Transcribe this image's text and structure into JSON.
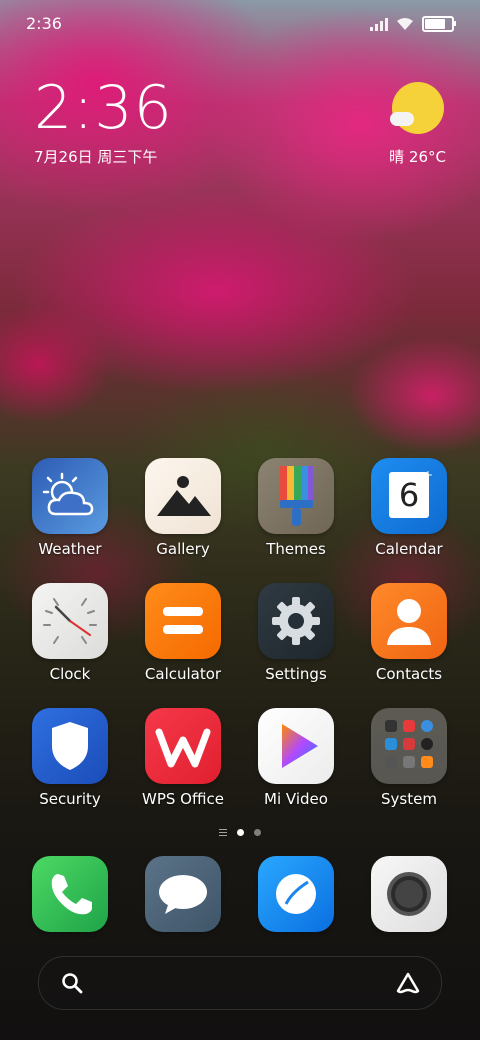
{
  "status_bar": {
    "time": "2:36",
    "battery_level": 0.85
  },
  "lockclock": {
    "time": "2:36",
    "date": "7月26日 周三下午"
  },
  "weather_widget": {
    "text": "晴 26°C",
    "icon": "sun-with-cloud-icon",
    "sun_color": "#f6d23a"
  },
  "apps": [
    {
      "label": "Weather",
      "icon": "weather-icon"
    },
    {
      "label": "Gallery",
      "icon": "gallery-icon"
    },
    {
      "label": "Themes",
      "icon": "themes-icon"
    },
    {
      "label": "Calendar",
      "icon": "calendar-icon",
      "icon_text": "6"
    },
    {
      "label": "Clock",
      "icon": "clock-icon"
    },
    {
      "label": "Calculator",
      "icon": "calculator-icon"
    },
    {
      "label": "Settings",
      "icon": "settings-icon"
    },
    {
      "label": "Contacts",
      "icon": "contacts-icon"
    },
    {
      "label": "Security",
      "icon": "security-icon"
    },
    {
      "label": "WPS Office",
      "icon": "wps-office-icon"
    },
    {
      "label": "Mi Video",
      "icon": "mi-video-icon"
    },
    {
      "label": "System",
      "icon": "system-folder-icon"
    }
  ],
  "page_indicator": {
    "pages": 2,
    "current": 1
  },
  "dock": [
    {
      "icon": "phone-icon"
    },
    {
      "icon": "messages-icon"
    },
    {
      "icon": "browser-icon"
    },
    {
      "icon": "camera-icon"
    }
  ],
  "search_bar": {
    "left_icon": "search-icon",
    "right_icon": "app-vault-icon"
  }
}
